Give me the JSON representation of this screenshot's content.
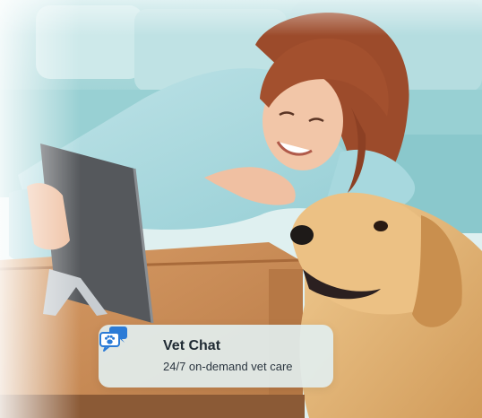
{
  "badge": {
    "icon": "chat-paw-icon",
    "title": "Vet Chat",
    "subtitle": "24/7 on-demand vet care"
  },
  "colors": {
    "sofa": "#8fcbcf",
    "sweater": "#a9d9df",
    "hair": "#9a4a2c",
    "table": "#c98e5a",
    "dog": "#e2b577",
    "tablet": "#55585c",
    "icon_blue": "#2b7bd6"
  }
}
